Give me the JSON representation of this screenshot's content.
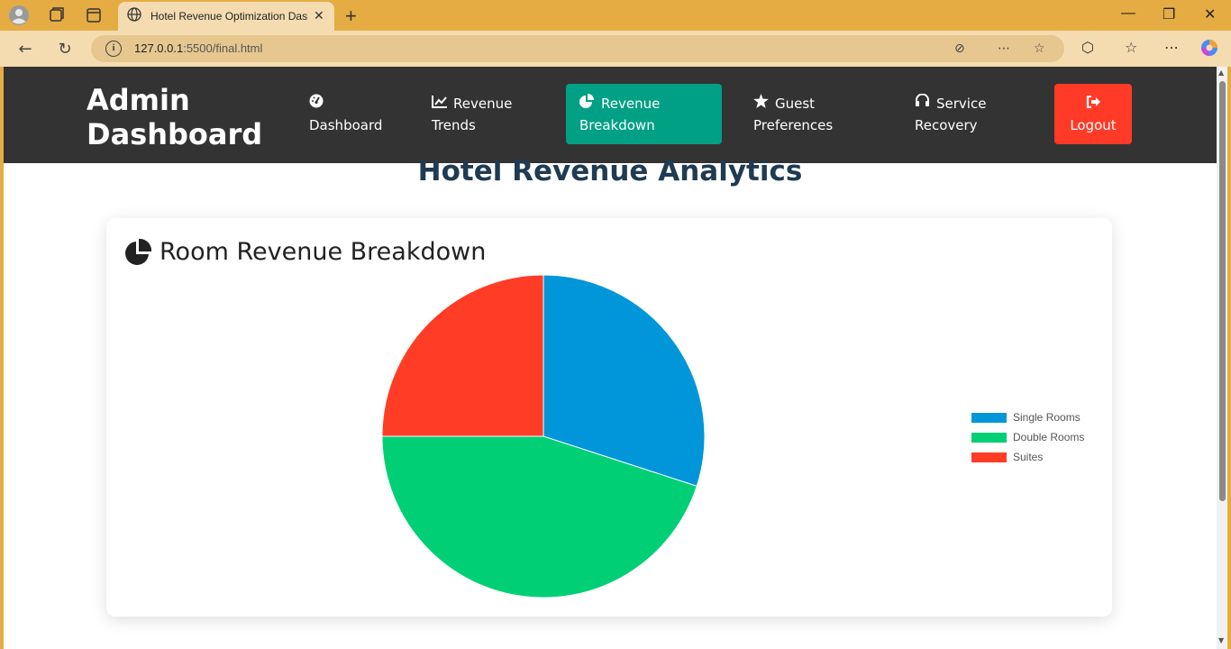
{
  "browser": {
    "tab_title": "Hotel Revenue Optimization Dash",
    "url_host": "127.0.0.1",
    "url_rest": ":5500/final.html"
  },
  "header": {
    "brand_line1": "Admin",
    "brand_line2": "Dashboard",
    "nav": [
      {
        "line1": "",
        "line2": "Dashboard",
        "icon": "dashboard-icon"
      },
      {
        "line1": "Revenue",
        "line2": "Trends",
        "icon": "line-chart-icon"
      },
      {
        "line1": "Revenue",
        "line2": "Breakdown",
        "icon": "pie-chart-icon"
      },
      {
        "line1": "Guest",
        "line2": "Preferences",
        "icon": "star-icon"
      },
      {
        "line1": "Service",
        "line2": "Recovery",
        "icon": "headset-icon"
      },
      {
        "line1": "",
        "line2": "Logout",
        "icon": "sign-out-icon"
      }
    ],
    "active_color": "#00a085",
    "logout_color": "#ff3b28"
  },
  "page": {
    "title": "Hotel Revenue Analytics"
  },
  "card": {
    "title": "Room Revenue Breakdown",
    "icon": "pie-chart-icon"
  },
  "chart_data": {
    "type": "pie",
    "categories": [
      "Single Rooms",
      "Double Rooms",
      "Suites"
    ],
    "values": [
      30,
      45,
      25
    ],
    "colors": [
      "#0096d9",
      "#00cf75",
      "#ff3c25"
    ],
    "legend": "right"
  }
}
